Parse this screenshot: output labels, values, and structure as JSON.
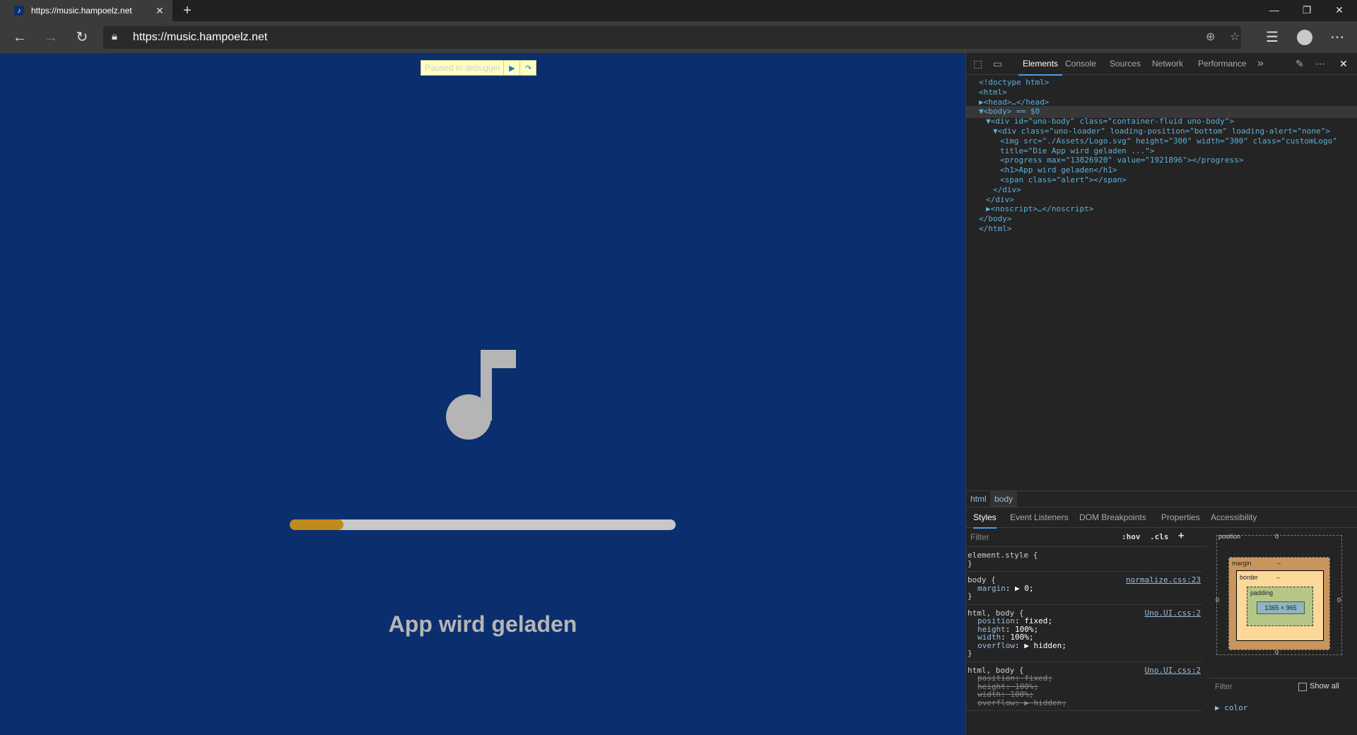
{
  "browser": {
    "tab_title": "https://music.hampoelz.net",
    "tab_close": "✕",
    "new_tab": "+",
    "url": "https://music.hampoelz.net"
  },
  "page": {
    "paused_label": "Paused in debugger",
    "loading_text": "App wird geladen",
    "progress": {
      "max": 13826920,
      "value": 1921896
    },
    "colors": {
      "background": "#0b2f6e",
      "progress_fill": "#c08a1e",
      "progress_track": "#c8c8c8",
      "logo": "#b5b5b5"
    }
  },
  "devtools": {
    "tabs": [
      "Elements",
      "Console",
      "Sources",
      "Network",
      "Performance"
    ],
    "more_tabs": "»",
    "dom": [
      {
        "indent": 0,
        "html": "<!doctype html>"
      },
      {
        "indent": 0,
        "html": "<html>"
      },
      {
        "indent": 0,
        "html": "▶<head>…</head>"
      },
      {
        "indent": 0,
        "html": "▼<body> == $0",
        "selected": true
      },
      {
        "indent": 1,
        "html": "▼<div id=\"uno-body\" class=\"container-fluid uno-body\">"
      },
      {
        "indent": 2,
        "html": "▼<div class=\"uno-loader\" loading-position=\"bottom\" loading-alert=\"none\">"
      },
      {
        "indent": 3,
        "html": "<img src=\"./Assets/Logo.svg\" height=\"300\" width=\"300\" class=\"customLogo\""
      },
      {
        "indent": 3,
        "html": "title=\"Die App wird geladen ...\">"
      },
      {
        "indent": 3,
        "html": "<progress max=\"13826920\" value=\"1921896\"></progress>"
      },
      {
        "indent": 3,
        "html": "<h1>App wird geladen</h1>"
      },
      {
        "indent": 3,
        "html": "<span class=\"alert\"></span>"
      },
      {
        "indent": 2,
        "html": "</div>"
      },
      {
        "indent": 1,
        "html": "</div>"
      },
      {
        "indent": 1,
        "html": "▶<noscript>…</noscript>"
      },
      {
        "indent": 0,
        "html": "</body>"
      },
      {
        "indent": 0,
        "html": "</html>"
      }
    ],
    "breadcrumbs": [
      "html",
      "body"
    ],
    "subtabs": [
      "Styles",
      "Event Listeners",
      "DOM Breakpoints",
      "Properties",
      "Accessibility"
    ],
    "styles_filter": "Filter",
    "hov": ":hov",
    "cls": ".cls",
    "add_rule": "+",
    "rules": [
      {
        "selector": "element.style {",
        "source": "",
        "props": [],
        "close": "}"
      },
      {
        "selector": "body {",
        "source": "normalize.css:23",
        "props": [
          {
            "name": "margin",
            "value": "▶ 0;"
          }
        ],
        "close": "}"
      },
      {
        "selector": "html, body {",
        "source": "Uno.UI.css:2",
        "props": [
          {
            "name": "position",
            "value": "fixed;"
          },
          {
            "name": "height",
            "value": "100%;"
          },
          {
            "name": "width",
            "value": "100%;"
          },
          {
            "name": "overflow",
            "value": "▶ hidden;"
          }
        ],
        "close": "}"
      },
      {
        "selector": "html, body {",
        "source": "Uno.UI.css:2",
        "props": [
          {
            "name": "position",
            "value": "fixed;",
            "struck": true
          },
          {
            "name": "height",
            "value": "100%;",
            "struck": true
          },
          {
            "name": "width",
            "value": "100%;",
            "struck": true
          },
          {
            "name": "overflow",
            "value": "▶ hidden;",
            "struck": true
          }
        ],
        "close": ""
      }
    ],
    "boxmodel": {
      "position_label": "position",
      "margin_label": "margin",
      "border_label": "border",
      "padding_label": "padding",
      "content": "1365 × 965",
      "top_zero": "0",
      "bottom_zero": "0",
      "left_zero": "0",
      "right_zero": "0",
      "dash": "–"
    },
    "computed_filter": "Filter",
    "show_all": "Show all",
    "computed_first": "▶ color"
  }
}
